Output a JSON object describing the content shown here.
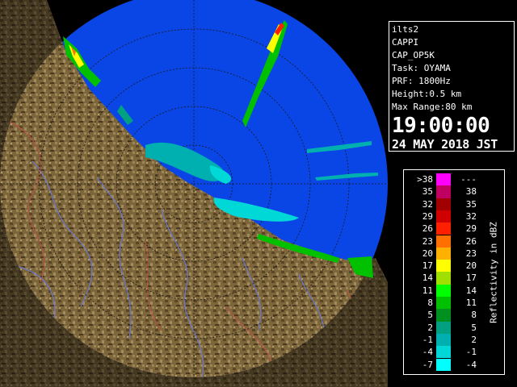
{
  "info": {
    "site": "ilts2",
    "product": "CAPPI",
    "product_code": "CAP_OP5K",
    "task": "Task: OYAMA",
    "prf": "PRF: 1800Hz",
    "height": "Height:0.5 km",
    "max_range": "Max Range:80 km",
    "time": "19:00:00",
    "date": "24 MAY 2018 JST"
  },
  "legend": {
    "unit": "Reflectivity in dBZ",
    "rows": [
      {
        "lo": ">38",
        "hi": "---",
        "color": "#ff00ff"
      },
      {
        "lo": "35",
        "hi": "38",
        "color": "#c00060"
      },
      {
        "lo": "32",
        "hi": "35",
        "color": "#a00000"
      },
      {
        "lo": "29",
        "hi": "32",
        "color": "#d00000"
      },
      {
        "lo": "26",
        "hi": "29",
        "color": "#ff2000"
      },
      {
        "lo": "23",
        "hi": "26",
        "color": "#ff7000"
      },
      {
        "lo": "20",
        "hi": "23",
        "color": "#ffb000"
      },
      {
        "lo": "17",
        "hi": "20",
        "color": "#ffff00"
      },
      {
        "lo": "14",
        "hi": "17",
        "color": "#a0e000"
      },
      {
        "lo": "11",
        "hi": "14",
        "color": "#00ff00"
      },
      {
        "lo": "8",
        "hi": "11",
        "color": "#00c000"
      },
      {
        "lo": "5",
        "hi": "8",
        "color": "#009020"
      },
      {
        "lo": "2",
        "hi": "5",
        "color": "#00a080"
      },
      {
        "lo": "-1",
        "hi": "2",
        "color": "#00b0b0"
      },
      {
        "lo": "-4",
        "hi": "-1",
        "color": "#00d8d8"
      },
      {
        "lo": "-7",
        "hi": "-4",
        "color": "#00ffff"
      }
    ]
  },
  "colors": {
    "radar_background": "#0a46e6",
    "land": "#7a6438",
    "rivers": "#6a78d0",
    "boundaries": "#c0504a",
    "range_rings": "#202020"
  }
}
